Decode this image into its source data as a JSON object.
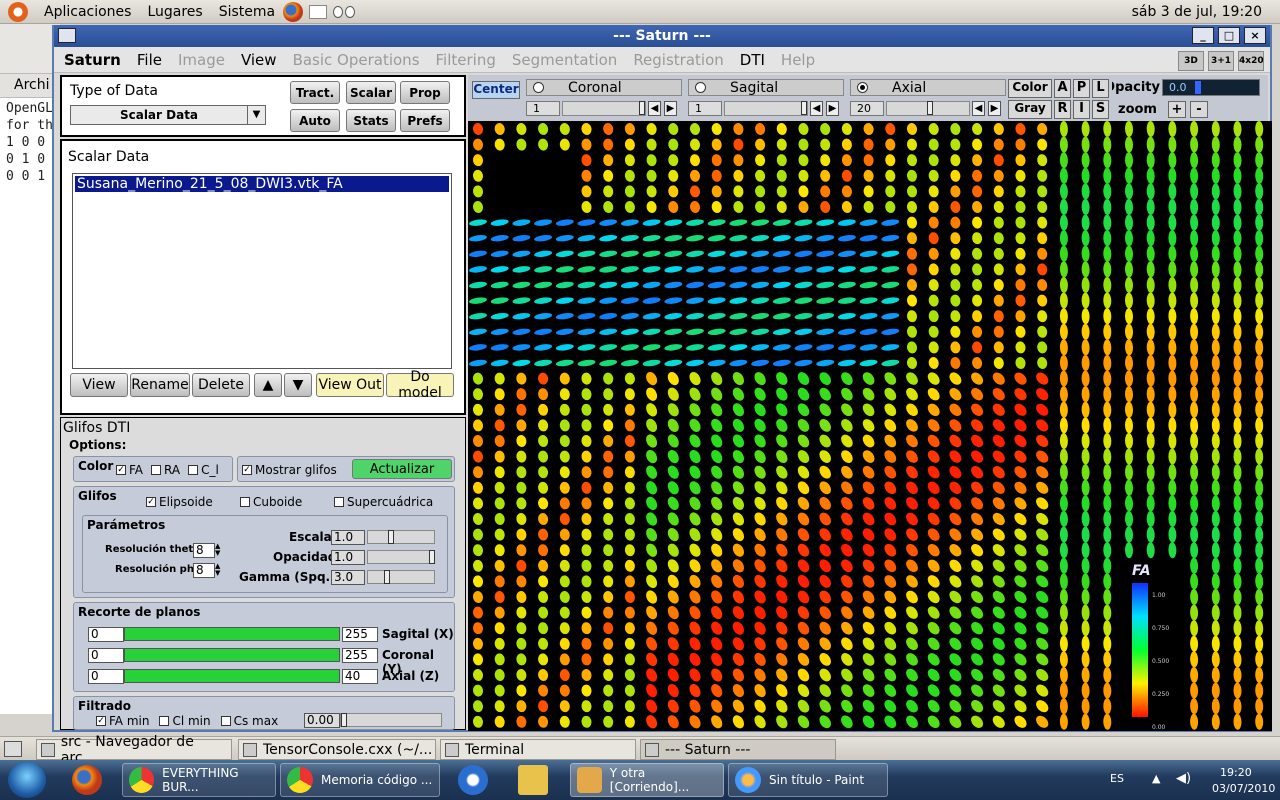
{
  "gnome_top": {
    "menus": [
      "Aplicaciones",
      "Lugares",
      "Sistema"
    ],
    "clock": "sáb  3 de jul, 19:20"
  },
  "terminal_bg": {
    "menu_label": "Archi",
    "lines": [
      "OpenGL",
      "for th",
      "1 0 0",
      "0 1 0",
      "0 0 1"
    ]
  },
  "window": {
    "title": "--- Saturn ---",
    "controls": [
      "_",
      "□",
      "×"
    ]
  },
  "menubar": {
    "items": [
      {
        "label": "Saturn",
        "state": "bold"
      },
      {
        "label": "File",
        "state": "en"
      },
      {
        "label": "Image",
        "state": "dis"
      },
      {
        "label": "View",
        "state": "en"
      },
      {
        "label": "Basic Operations",
        "state": "dis"
      },
      {
        "label": "Filtering",
        "state": "dis"
      },
      {
        "label": "Segmentation",
        "state": "dis"
      },
      {
        "label": "Registration",
        "state": "dis"
      },
      {
        "label": "DTI",
        "state": "en"
      },
      {
        "label": "Help",
        "state": "dis"
      }
    ],
    "layout_buttons": [
      "3D",
      "3+1",
      "4x20"
    ]
  },
  "type_panel": {
    "label": "Type of Data",
    "combo_value": "Scalar Data",
    "buttons": [
      "Tract.",
      "Scalar",
      "Prop",
      "Auto",
      "Stats",
      "Prefs"
    ]
  },
  "scalar_panel": {
    "label": "Scalar Data",
    "items": [
      "Susana_Merino_21_5_08_DWI3.vtk_FA"
    ],
    "buttons": [
      "View",
      "Rename",
      "Delete",
      "▲",
      "▼",
      "View Out",
      "Do model"
    ]
  },
  "glifos": {
    "title": "Glifos DTI",
    "options_label": "Options:",
    "color_label": "Color",
    "color_opts": [
      {
        "label": "FA",
        "checked": true
      },
      {
        "label": "RA",
        "checked": false
      },
      {
        "label": "C_l",
        "checked": false
      }
    ],
    "mostrar_label": "Mostrar glifos",
    "mostrar_checked": true,
    "actualizar": "Actualizar",
    "glifos_label": "Glifos",
    "glyph_opts": [
      {
        "label": "Elipsoide",
        "checked": true
      },
      {
        "label": "Cuboide",
        "checked": false
      },
      {
        "label": "Supercuádrica",
        "checked": false
      }
    ],
    "params_label": "Parámetros",
    "res_theta_label": "Resolución theta",
    "res_theta": "8",
    "res_phi_label": "Resolución phi",
    "res_phi": "8",
    "escala_label": "Escala",
    "escala": "1.0",
    "opacidad_label": "Opacidad",
    "opacidad": "1.0",
    "gamma_label": "Gamma (Spq.)",
    "gamma": "3.0",
    "recorte_label": "Recorte de planos",
    "planes": [
      {
        "min": "0",
        "max": "255",
        "label": "Sagital (X)"
      },
      {
        "min": "0",
        "max": "255",
        "label": "Coronal (Y)"
      },
      {
        "min": "0",
        "max": "40",
        "label": "Axial (Z)"
      }
    ],
    "filtrado_label": "Filtrado",
    "filters": [
      {
        "label": "FA min",
        "checked": true
      },
      {
        "label": "Cl min",
        "checked": false
      },
      {
        "label": "Cs max",
        "checked": false
      }
    ],
    "filter_value": "0.00"
  },
  "viewbar": {
    "center": "Center",
    "planes": [
      {
        "label": "Coronal",
        "selected": false,
        "slice": "1"
      },
      {
        "label": "Sagital",
        "selected": false,
        "slice": "1"
      },
      {
        "label": "Axial",
        "selected": true,
        "slice": "20"
      }
    ],
    "color_btn": "Color",
    "gray_btn": "Gray",
    "orient_top": [
      "A",
      "P",
      "L"
    ],
    "orient_bot": [
      "R",
      "I",
      "S"
    ],
    "opacity_label": "Opacity",
    "opacity_value": "0.0",
    "zoom_label": "zoom",
    "zoom_plus": "+",
    "zoom_minus": "-"
  },
  "colorbar": {
    "label": "FA",
    "ticks": [
      "1.00",
      "0.750",
      "0.500",
      "0.250",
      "0.00"
    ]
  },
  "gnome_bottom": {
    "tasks": [
      "src - Navegador de arc...",
      "TensorConsole.cxx (~/...",
      "Terminal",
      "--- Saturn ---"
    ]
  },
  "win_taskbar": {
    "tasks": [
      "EVERYTHING BUR...",
      "Memoria código ...",
      "Y otra [Corriendo]...",
      "Sin título - Paint"
    ],
    "lang": "ES",
    "time": "19:20",
    "date": "03/07/2010"
  }
}
